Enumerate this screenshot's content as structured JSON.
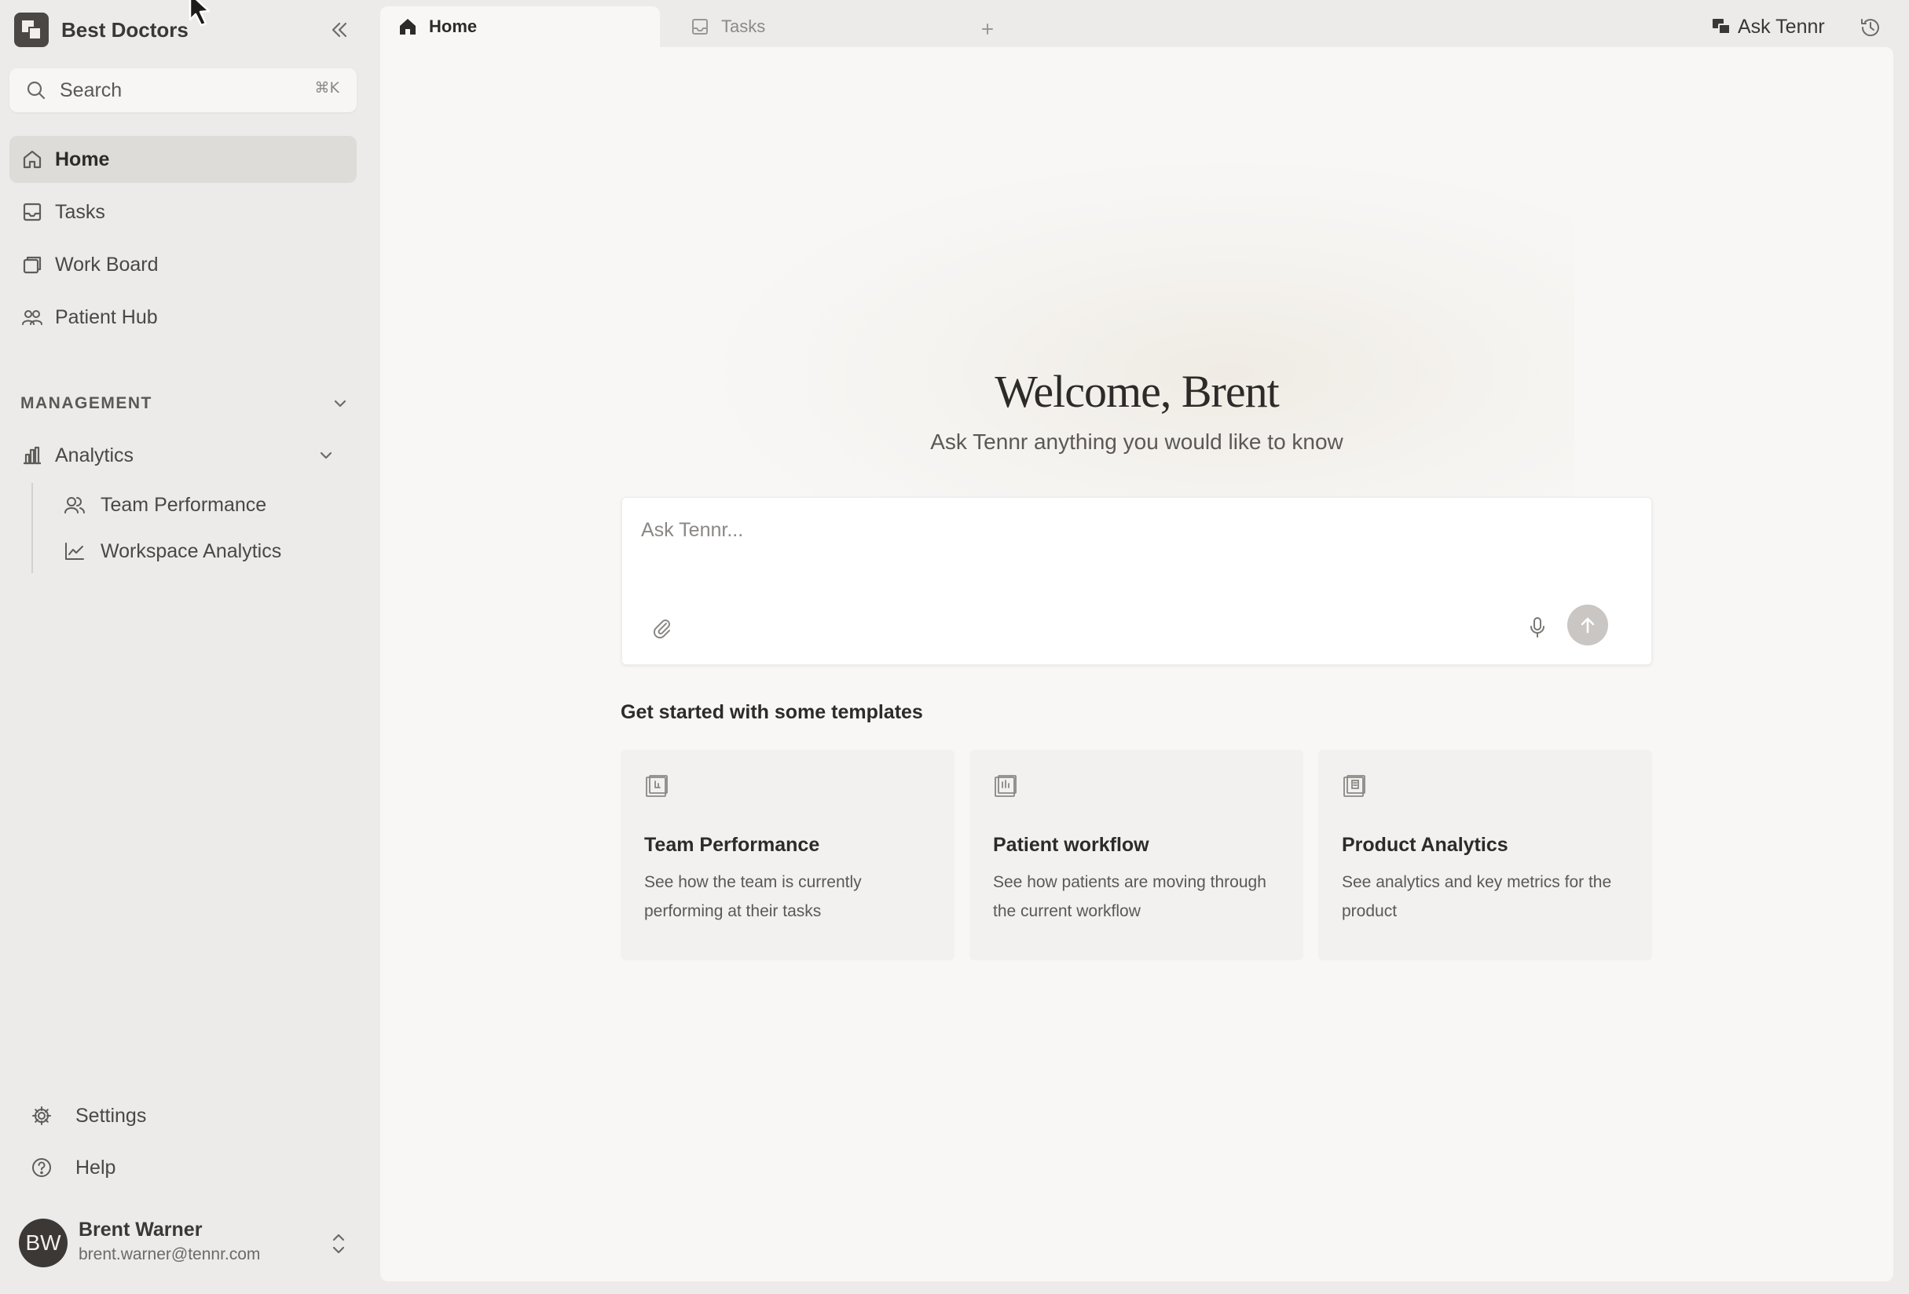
{
  "workspace": {
    "name": "Best Doctors"
  },
  "search": {
    "label": "Search",
    "shortcut": "⌘K"
  },
  "nav": {
    "items": [
      {
        "label": "Home",
        "icon": "home-icon",
        "active": true
      },
      {
        "label": "Tasks",
        "icon": "inbox-icon"
      },
      {
        "label": "Work Board",
        "icon": "board-icon"
      },
      {
        "label": "Patient Hub",
        "icon": "users-icon"
      }
    ]
  },
  "management": {
    "heading": "MANAGEMENT",
    "analytics": {
      "label": "Analytics",
      "children": [
        {
          "label": "Team Performance",
          "icon": "team-icon"
        },
        {
          "label": "Workspace Analytics",
          "icon": "line-chart-icon"
        }
      ]
    }
  },
  "footer": {
    "settings_label": "Settings",
    "help_label": "Help",
    "user": {
      "initials": "BW",
      "name": "Brent Warner",
      "email": "brent.warner@tennr.com"
    }
  },
  "tabs": [
    {
      "label": "Home",
      "icon": "home-filled-icon",
      "active": true
    },
    {
      "label": "Tasks",
      "icon": "inbox-icon",
      "active": false
    }
  ],
  "topbar": {
    "ask_tennr_label": "Ask Tennr"
  },
  "main": {
    "welcome": "Welcome, Brent",
    "subtitle": "Ask Tennr anything you would like to know",
    "ask_placeholder": "Ask Tennr...",
    "templates_heading": "Get started with some templates",
    "templates": [
      {
        "title": "Team Performance",
        "description": "See how the team is currently performing at their tasks"
      },
      {
        "title": "Patient workflow",
        "description": "See how patients are moving through the current workflow"
      },
      {
        "title": "Product Analytics",
        "description": "See analytics and key metrics for the product"
      }
    ]
  },
  "colors": {
    "sidebar_bg": "#ecebe9",
    "content_bg": "#f8f7f6",
    "active_nav_bg": "#dedcd9",
    "send_button": "#c9c6c3",
    "text_primary": "#2d2b29"
  }
}
